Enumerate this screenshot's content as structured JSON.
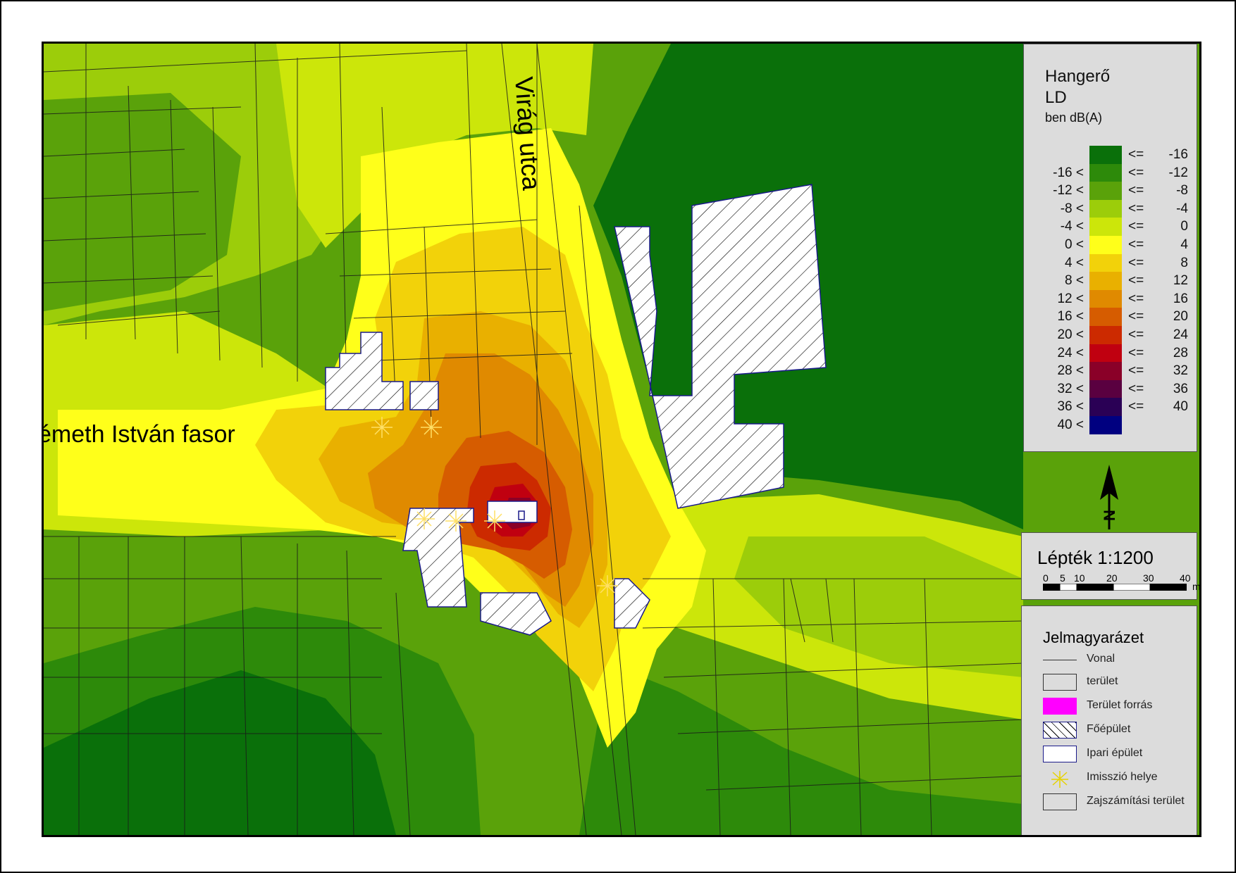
{
  "map": {
    "streets": [
      {
        "label": "Virág utca"
      },
      {
        "label": "émeth István fasor"
      }
    ],
    "colors": {
      "background_green": "#2d8a0a",
      "dark_green": "#0a700a",
      "hatch_fill": "#ffffff",
      "hatch_line": "#000000"
    }
  },
  "legend": {
    "title1": "Hangerő",
    "title2": "LD",
    "subtitle": "ben dB(A)",
    "rows": [
      {
        "lower": "",
        "upper": "-16",
        "color": "#0a700a"
      },
      {
        "lower": "-16",
        "upper": "-12",
        "color": "#2d8a0a"
      },
      {
        "lower": "-12",
        "upper": "-8",
        "color": "#5aa20a"
      },
      {
        "lower": "-8",
        "upper": "-4",
        "color": "#9ccd0a"
      },
      {
        "lower": "-4",
        "upper": "0",
        "color": "#cce60a"
      },
      {
        "lower": "0",
        "upper": "4",
        "color": "#ffff1a"
      },
      {
        "lower": "4",
        "upper": "8",
        "color": "#f2d20a"
      },
      {
        "lower": "8",
        "upper": "12",
        "color": "#e9b000"
      },
      {
        "lower": "12",
        "upper": "16",
        "color": "#e08a00"
      },
      {
        "lower": "16",
        "upper": "20",
        "color": "#d65c00"
      },
      {
        "lower": "20",
        "upper": "24",
        "color": "#cc2a00"
      },
      {
        "lower": "24",
        "upper": "28",
        "color": "#c00010"
      },
      {
        "lower": "28",
        "upper": "32",
        "color": "#8a0028"
      },
      {
        "lower": "32",
        "upper": "36",
        "color": "#5a0040"
      },
      {
        "lower": "36",
        "upper": "40",
        "color": "#2a0055"
      },
      {
        "lower": "40",
        "upper": "",
        "color": "#000080"
      }
    ],
    "le_symbol": "<=",
    "lt_symbol": "<"
  },
  "scale": {
    "title": "Lépték 1:1200",
    "ticks": [
      "0",
      "5",
      "10",
      "20",
      "30",
      "40"
    ],
    "unit": "m"
  },
  "key": {
    "title": "Jelmagyarázet",
    "items": [
      {
        "label": "Vonal",
        "symbol": "line"
      },
      {
        "label": "terület",
        "symbol": "box"
      },
      {
        "label": "Terület forrás",
        "symbol": "magenta"
      },
      {
        "label": "Főépület",
        "symbol": "hatch"
      },
      {
        "label": "Ipari épület",
        "symbol": "blue-box"
      },
      {
        "label": "Imisszió helye",
        "symbol": "star"
      },
      {
        "label": "Zajszámítási terület",
        "symbol": "box"
      }
    ]
  },
  "north_arrow": {
    "label": "N"
  }
}
